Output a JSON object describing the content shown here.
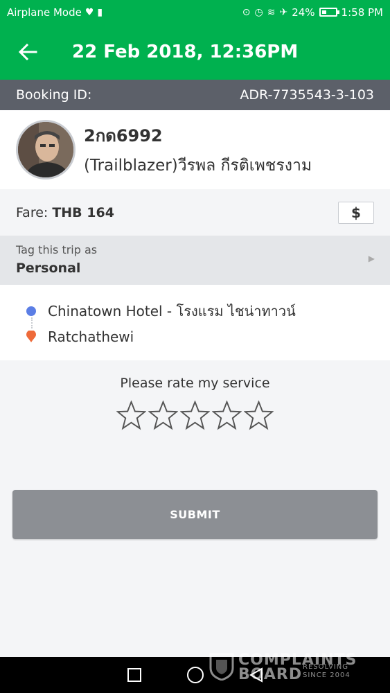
{
  "status_bar": {
    "mode": "Airplane Mode",
    "battery": "24%",
    "time": "1:58 PM"
  },
  "header": {
    "title": "22 Feb 2018, 12:36PM"
  },
  "booking": {
    "label": "Booking ID:",
    "id": "ADR-7735543-3-103"
  },
  "driver": {
    "plate": "2กด6992",
    "name": "(Trailblazer)วีรพล กีรติเพชรงาม"
  },
  "fare": {
    "label": "Fare:",
    "value": "THB 164",
    "payment_icon": "$"
  },
  "tag": {
    "label": "Tag this trip as",
    "value": "Personal"
  },
  "route": {
    "pickup": "Chinatown Hotel - โรงแรม ไชน่าทาวน์",
    "dropoff": "Ratchathewi"
  },
  "rating": {
    "prompt": "Please rate my service",
    "stars": 0,
    "max_stars": 5
  },
  "submit": {
    "label": "SUBMIT"
  },
  "watermark": {
    "line1": "COMPLAINTS",
    "line2": "BOARD",
    "sub1": "RESOLVING",
    "sub2": "SINCE 2004"
  },
  "colors": {
    "brand_green": "#00b14f",
    "booking_bar": "#5c6069",
    "submit_disabled": "#8c8f94",
    "pickup_blue": "#5b7ee5",
    "dropoff_orange": "#ee6a3a"
  }
}
